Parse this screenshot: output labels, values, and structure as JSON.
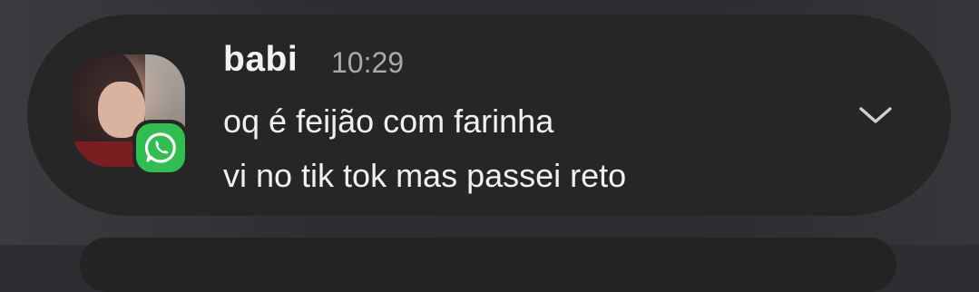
{
  "notification": {
    "app_icon": "whatsapp-icon",
    "sender": "babi",
    "time": "10:29",
    "messages": [
      "oq é feijão com farinha",
      "vi no tik tok mas passei reto"
    ],
    "expand_icon": "chevron-down-icon"
  },
  "colors": {
    "card_background": "#262626",
    "whatsapp_green": "#2fbe4f",
    "primary_text": "#f0f0f0",
    "secondary_text": "#a9a9a9"
  }
}
